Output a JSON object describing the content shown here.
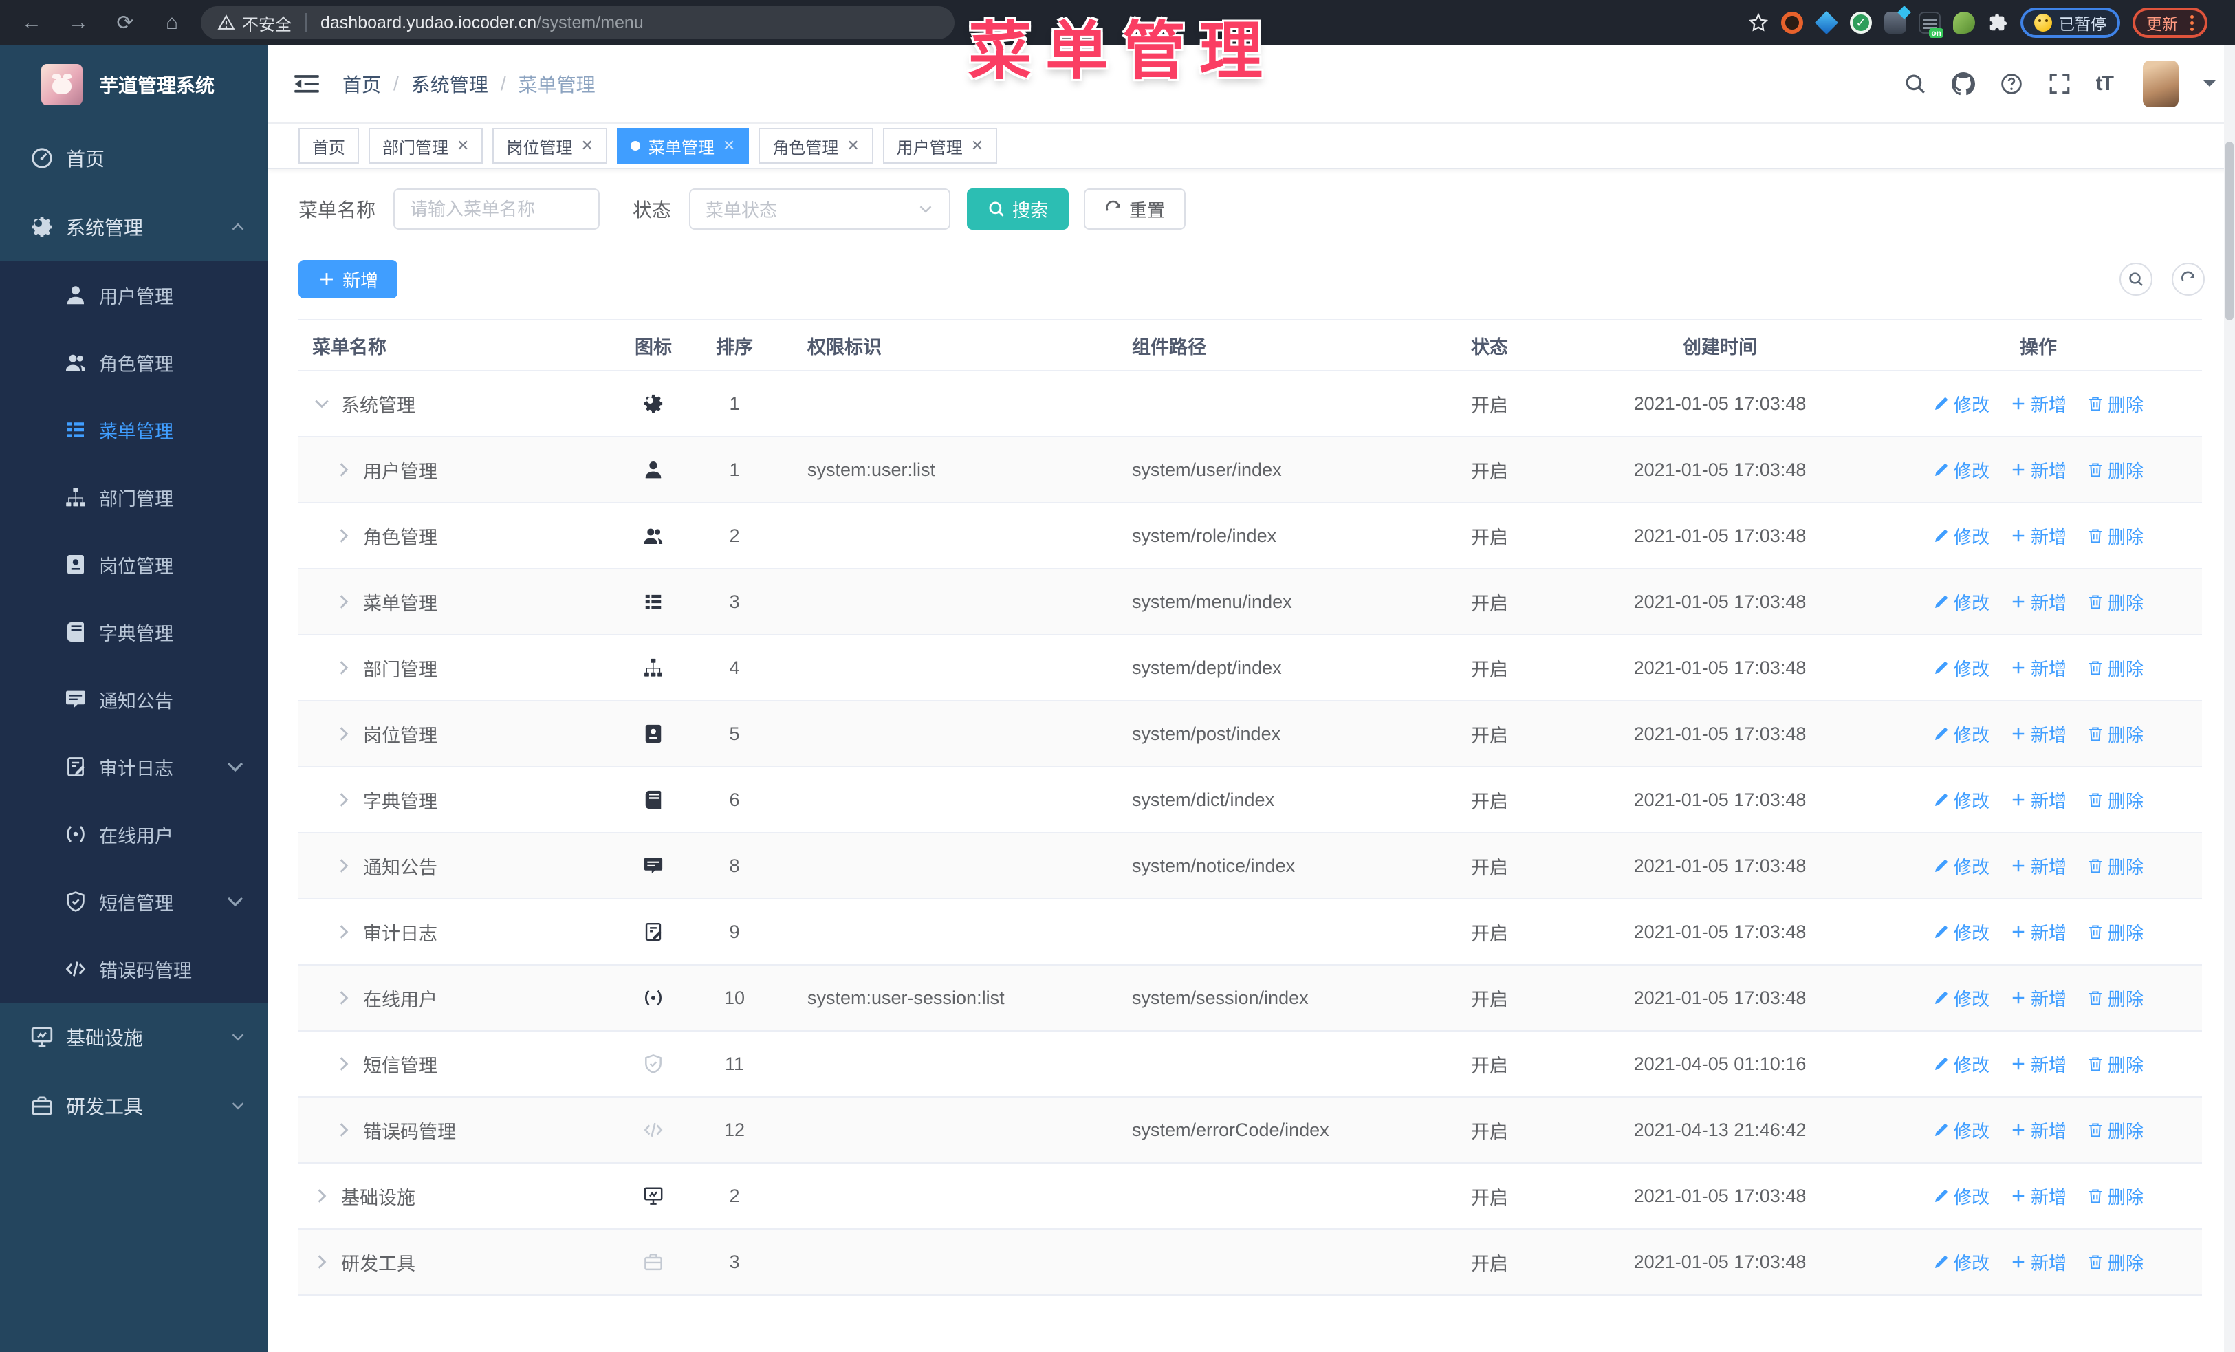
{
  "browser": {
    "security_label": "不安全",
    "url_host": "dashboard.yudao.iocoder.cn",
    "url_path": "/system/menu",
    "extension_on_badge": "on",
    "paused_badge": "已暂停",
    "update_button": "更新"
  },
  "watermark_text": "菜单管理",
  "colors": {
    "primary": "#409eff",
    "search_button": "#2cbeb3",
    "watermark": "#fa3e63",
    "sidebar_bg": "#24455e",
    "submenu_bg": "#1e2e4a"
  },
  "sidebar": {
    "app_title": "芋道管理系统",
    "items": [
      {
        "key": "home",
        "label": "首页",
        "icon": "dashboard"
      },
      {
        "key": "system",
        "label": "系统管理",
        "icon": "gear",
        "expanded": true,
        "chevron": "up",
        "children": [
          {
            "key": "user",
            "label": "用户管理",
            "icon": "user"
          },
          {
            "key": "role",
            "label": "角色管理",
            "icon": "users"
          },
          {
            "key": "menu",
            "label": "菜单管理",
            "icon": "menu-list",
            "active": true
          },
          {
            "key": "dept",
            "label": "部门管理",
            "icon": "org-tree"
          },
          {
            "key": "post",
            "label": "岗位管理",
            "icon": "badge"
          },
          {
            "key": "dict",
            "label": "字典管理",
            "icon": "book"
          },
          {
            "key": "notice",
            "label": "通知公告",
            "icon": "message"
          },
          {
            "key": "audit-log",
            "label": "审计日志",
            "icon": "doc-edit",
            "chevron": "down"
          },
          {
            "key": "online-user",
            "label": "在线用户",
            "icon": "online"
          },
          {
            "key": "sms",
            "label": "短信管理",
            "icon": "shield",
            "chevron": "down"
          },
          {
            "key": "error-code",
            "label": "错误码管理",
            "icon": "code"
          }
        ]
      },
      {
        "key": "infra",
        "label": "基础设施",
        "icon": "monitor",
        "chevron": "down"
      },
      {
        "key": "dev-tools",
        "label": "研发工具",
        "icon": "toolbox",
        "chevron": "down"
      }
    ]
  },
  "header": {
    "breadcrumb": [
      "首页",
      "系统管理",
      "菜单管理"
    ]
  },
  "tabs": [
    {
      "key": "home",
      "label": "首页"
    },
    {
      "key": "dept",
      "label": "部门管理",
      "closable": true
    },
    {
      "key": "post",
      "label": "岗位管理",
      "closable": true
    },
    {
      "key": "menu",
      "label": "菜单管理",
      "closable": true,
      "active": true
    },
    {
      "key": "role",
      "label": "角色管理",
      "closable": true
    },
    {
      "key": "user",
      "label": "用户管理",
      "closable": true
    }
  ],
  "filters": {
    "name_label": "菜单名称",
    "name_placeholder": "请输入菜单名称",
    "status_label": "状态",
    "status_placeholder": "菜单状态",
    "search_button": "搜索",
    "reset_button": "重置"
  },
  "toolbar": {
    "add_button": "新增"
  },
  "table": {
    "columns": [
      "菜单名称",
      "图标",
      "排序",
      "权限标识",
      "组件路径",
      "状态",
      "创建时间",
      "操作"
    ],
    "row_actions": {
      "edit": "修改",
      "add": "新增",
      "delete": "删除"
    },
    "rows": [
      {
        "key": "system",
        "name": "系统管理",
        "icon": "gear",
        "level": 0,
        "expanded": true,
        "sort": "1",
        "perm": "",
        "path": "",
        "status": "开启",
        "time": "2021-01-05 17:03:48"
      },
      {
        "key": "user",
        "name": "用户管理",
        "icon": "user",
        "level": 1,
        "sort": "1",
        "perm": "system:user:list",
        "path": "system/user/index",
        "status": "开启",
        "time": "2021-01-05 17:03:48"
      },
      {
        "key": "role",
        "name": "角色管理",
        "icon": "users",
        "level": 1,
        "sort": "2",
        "perm": "",
        "path": "system/role/index",
        "status": "开启",
        "time": "2021-01-05 17:03:48"
      },
      {
        "key": "menu",
        "name": "菜单管理",
        "icon": "menu-list",
        "level": 1,
        "sort": "3",
        "perm": "",
        "path": "system/menu/index",
        "status": "开启",
        "time": "2021-01-05 17:03:48"
      },
      {
        "key": "dept",
        "name": "部门管理",
        "icon": "org-tree",
        "level": 1,
        "sort": "4",
        "perm": "",
        "path": "system/dept/index",
        "status": "开启",
        "time": "2021-01-05 17:03:48"
      },
      {
        "key": "post",
        "name": "岗位管理",
        "icon": "badge",
        "level": 1,
        "sort": "5",
        "perm": "",
        "path": "system/post/index",
        "status": "开启",
        "time": "2021-01-05 17:03:48"
      },
      {
        "key": "dict",
        "name": "字典管理",
        "icon": "book",
        "level": 1,
        "sort": "6",
        "perm": "",
        "path": "system/dict/index",
        "status": "开启",
        "time": "2021-01-05 17:03:48"
      },
      {
        "key": "notice",
        "name": "通知公告",
        "icon": "message",
        "level": 1,
        "sort": "8",
        "perm": "",
        "path": "system/notice/index",
        "status": "开启",
        "time": "2021-01-05 17:03:48"
      },
      {
        "key": "audit-log",
        "name": "审计日志",
        "icon": "doc-edit",
        "level": 1,
        "sort": "9",
        "perm": "",
        "path": "",
        "status": "开启",
        "time": "2021-01-05 17:03:48"
      },
      {
        "key": "online-user",
        "name": "在线用户",
        "icon": "online",
        "level": 1,
        "sort": "10",
        "perm": "system:user-session:list",
        "path": "system/session/index",
        "status": "开启",
        "time": "2021-01-05 17:03:48"
      },
      {
        "key": "sms",
        "name": "短信管理",
        "icon": "shield",
        "level": 1,
        "sort": "11",
        "perm": "",
        "path": "",
        "status": "开启",
        "time": "2021-04-05 01:10:16",
        "muted_icon": true
      },
      {
        "key": "error-code",
        "name": "错误码管理",
        "icon": "code",
        "level": 1,
        "sort": "12",
        "perm": "",
        "path": "system/errorCode/index",
        "status": "开启",
        "time": "2021-04-13 21:46:42",
        "muted_icon": true
      },
      {
        "key": "infra",
        "name": "基础设施",
        "icon": "monitor",
        "level": 0,
        "sort": "2",
        "perm": "",
        "path": "",
        "status": "开启",
        "time": "2021-01-05 17:03:48"
      },
      {
        "key": "dev-tools",
        "name": "研发工具",
        "icon": "toolbox",
        "level": 0,
        "sort": "3",
        "perm": "",
        "path": "",
        "status": "开启",
        "time": "2021-01-05 17:03:48",
        "muted_icon": true
      }
    ]
  }
}
